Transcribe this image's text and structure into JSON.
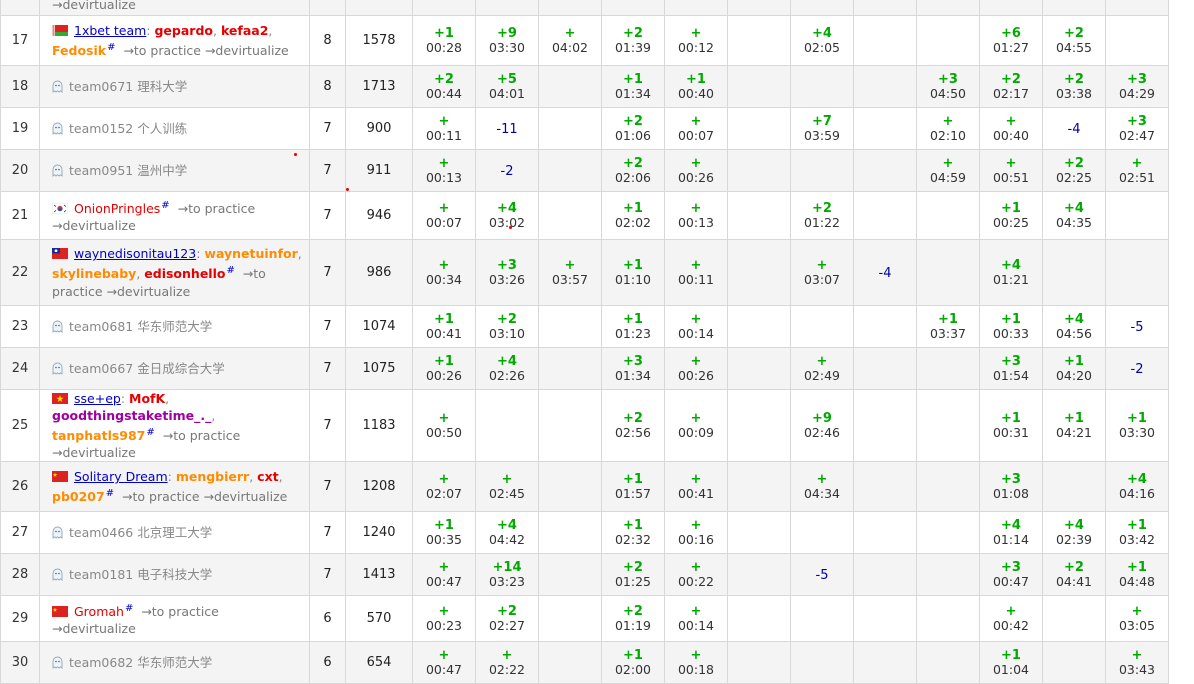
{
  "rows": [
    {
      "rank": "17",
      "solved": "8",
      "penalty": "1578",
      "flag": "by",
      "type": "named",
      "team": "1xbet team",
      "team_style": "link",
      "hash": true,
      "members": [
        {
          "name": "gepardo",
          "color": "red"
        },
        {
          "name": "kefaa2",
          "color": "red"
        },
        {
          "name": "Fedosik",
          "color": "orange"
        }
      ],
      "links": "→to practice →devirtualize",
      "cells": [
        [
          "+1",
          "00:28"
        ],
        [
          "+9",
          "03:30"
        ],
        [
          "+",
          "04:02"
        ],
        [
          "+2",
          "01:39"
        ],
        [
          "+",
          "00:12"
        ],
        [
          "",
          ""
        ],
        [
          "+4",
          "02:05"
        ],
        [
          "",
          ""
        ],
        [
          "",
          ""
        ],
        [
          "+6",
          "01:27"
        ],
        [
          "+2",
          "04:55"
        ],
        [
          "",
          ""
        ]
      ]
    },
    {
      "rank": "18",
      "solved": "8",
      "penalty": "1713",
      "type": "ghost",
      "team": "team0671 理科大学",
      "cells": [
        [
          "+2",
          "00:44"
        ],
        [
          "+5",
          "04:01"
        ],
        [
          "",
          ""
        ],
        [
          "+1",
          "01:34"
        ],
        [
          "+1",
          "00:40"
        ],
        [
          "",
          ""
        ],
        [
          "",
          ""
        ],
        [
          "",
          ""
        ],
        [
          "+3",
          "04:50"
        ],
        [
          "+2",
          "02:17"
        ],
        [
          "+2",
          "03:38"
        ],
        [
          "+3",
          "04:29"
        ]
      ]
    },
    {
      "rank": "19",
      "solved": "7",
      "penalty": "900",
      "type": "ghost",
      "team": "team0152 个人训练",
      "cells": [
        [
          "+",
          "00:11"
        ],
        [
          "-11",
          ""
        ],
        [
          "",
          ""
        ],
        [
          "+2",
          "01:06"
        ],
        [
          "+",
          "00:07"
        ],
        [
          "",
          ""
        ],
        [
          "+7",
          "03:59"
        ],
        [
          "",
          ""
        ],
        [
          "+",
          "02:10"
        ],
        [
          "+",
          "00:40"
        ],
        [
          "-4",
          ""
        ],
        [
          "+3",
          "02:47"
        ]
      ]
    },
    {
      "rank": "20",
      "solved": "7",
      "penalty": "911",
      "type": "ghost",
      "team": "team0951 温州中学",
      "cells": [
        [
          "+",
          "00:13"
        ],
        [
          "-2",
          ""
        ],
        [
          "",
          ""
        ],
        [
          "+2",
          "02:06"
        ],
        [
          "+",
          "00:26"
        ],
        [
          "",
          ""
        ],
        [
          "",
          ""
        ],
        [
          "",
          ""
        ],
        [
          "+",
          "04:59"
        ],
        [
          "+",
          "00:51"
        ],
        [
          "+2",
          "02:25"
        ],
        [
          "+",
          "02:51"
        ]
      ]
    },
    {
      "rank": "21",
      "solved": "7",
      "penalty": "946",
      "flag": "kr",
      "type": "named",
      "team": "OnionPringles",
      "team_style": "red",
      "hash": true,
      "members": [],
      "links": "→to practice →devirtualize",
      "cells": [
        [
          "+",
          "00:07"
        ],
        [
          "+4",
          "03:02"
        ],
        [
          "",
          ""
        ],
        [
          "+1",
          "02:02"
        ],
        [
          "+",
          "00:13"
        ],
        [
          "",
          ""
        ],
        [
          "+2",
          "01:22"
        ],
        [
          "",
          ""
        ],
        [
          "",
          ""
        ],
        [
          "+1",
          "00:25"
        ],
        [
          "+4",
          "04:35"
        ],
        [
          "",
          ""
        ]
      ]
    },
    {
      "rank": "22",
      "solved": "7",
      "penalty": "986",
      "flag": "tw",
      "type": "named",
      "team": "waynedisonitau123",
      "team_style": "link",
      "hash": true,
      "members": [
        {
          "name": "waynetuinfor",
          "color": "orange"
        },
        {
          "name": "skylinebaby",
          "color": "orange"
        },
        {
          "name": "edisonhello",
          "color": "red"
        }
      ],
      "links": "→to practice →devirtualize",
      "cells": [
        [
          "+",
          "00:34"
        ],
        [
          "+3",
          "03:26"
        ],
        [
          "+",
          "03:57"
        ],
        [
          "+1",
          "01:10"
        ],
        [
          "+",
          "00:11"
        ],
        [
          "",
          ""
        ],
        [
          "+",
          "03:07"
        ],
        [
          "-4",
          ""
        ],
        [
          "",
          ""
        ],
        [
          "+4",
          "01:21"
        ],
        [
          "",
          ""
        ],
        [
          "",
          ""
        ]
      ]
    },
    {
      "rank": "23",
      "solved": "7",
      "penalty": "1074",
      "type": "ghost",
      "team": "team0681 华东师范大学",
      "cells": [
        [
          "+1",
          "00:41"
        ],
        [
          "+2",
          "03:10"
        ],
        [
          "",
          ""
        ],
        [
          "+1",
          "01:23"
        ],
        [
          "+",
          "00:14"
        ],
        [
          "",
          ""
        ],
        [
          "",
          ""
        ],
        [
          "",
          ""
        ],
        [
          "+1",
          "03:37"
        ],
        [
          "+1",
          "00:33"
        ],
        [
          "+4",
          "04:56"
        ],
        [
          "-5",
          ""
        ]
      ]
    },
    {
      "rank": "24",
      "solved": "7",
      "penalty": "1075",
      "type": "ghost",
      "team": "team0667 金日成综合大学",
      "cells": [
        [
          "+1",
          "00:26"
        ],
        [
          "+4",
          "02:26"
        ],
        [
          "",
          ""
        ],
        [
          "+3",
          "01:34"
        ],
        [
          "+",
          "00:26"
        ],
        [
          "",
          ""
        ],
        [
          "+",
          "02:49"
        ],
        [
          "",
          ""
        ],
        [
          "",
          ""
        ],
        [
          "+3",
          "01:54"
        ],
        [
          "+1",
          "04:20"
        ],
        [
          "-2",
          ""
        ]
      ]
    },
    {
      "rank": "25",
      "solved": "7",
      "penalty": "1183",
      "flag": "vn",
      "type": "named",
      "team": "sse+ep",
      "team_style": "link",
      "hash": true,
      "members": [
        {
          "name": "MofK",
          "color": "red"
        },
        {
          "name": "goodthingstaketime_._",
          "color": "violet"
        },
        {
          "name": "tanphatls987",
          "color": "orange"
        }
      ],
      "links": "→to practice →devirtualize",
      "cells": [
        [
          "+",
          "00:50"
        ],
        [
          "",
          ""
        ],
        [
          "",
          ""
        ],
        [
          "+2",
          "02:56"
        ],
        [
          "+",
          "00:09"
        ],
        [
          "",
          ""
        ],
        [
          "+9",
          "02:46"
        ],
        [
          "",
          ""
        ],
        [
          "",
          ""
        ],
        [
          "+1",
          "00:31"
        ],
        [
          "+1",
          "04:21"
        ],
        [
          "+1",
          "03:30"
        ]
      ]
    },
    {
      "rank": "26",
      "solved": "7",
      "penalty": "1208",
      "flag": "cn",
      "type": "named",
      "team": "Solitary Dream",
      "team_style": "link",
      "hash": true,
      "members": [
        {
          "name": "mengbierr",
          "color": "orange"
        },
        {
          "name": "cxt",
          "color": "red"
        },
        {
          "name": "pb0207",
          "color": "orange"
        }
      ],
      "links": "→to practice →devirtualize",
      "cells": [
        [
          "+",
          "02:07"
        ],
        [
          "+",
          "02:45"
        ],
        [
          "",
          ""
        ],
        [
          "+1",
          "01:57"
        ],
        [
          "+",
          "00:41"
        ],
        [
          "",
          ""
        ],
        [
          "+",
          "04:34"
        ],
        [
          "",
          ""
        ],
        [
          "",
          ""
        ],
        [
          "+3",
          "01:08"
        ],
        [
          "",
          ""
        ],
        [
          "+4",
          "04:16"
        ]
      ]
    },
    {
      "rank": "27",
      "solved": "7",
      "penalty": "1240",
      "type": "ghost",
      "team": "team0466 北京理工大学",
      "cells": [
        [
          "+1",
          "00:35"
        ],
        [
          "+4",
          "04:42"
        ],
        [
          "",
          ""
        ],
        [
          "+1",
          "02:32"
        ],
        [
          "+",
          "00:16"
        ],
        [
          "",
          ""
        ],
        [
          "",
          ""
        ],
        [
          "",
          ""
        ],
        [
          "",
          ""
        ],
        [
          "+4",
          "01:14"
        ],
        [
          "+4",
          "02:39"
        ],
        [
          "+1",
          "03:42"
        ]
      ]
    },
    {
      "rank": "28",
      "solved": "7",
      "penalty": "1413",
      "type": "ghost",
      "team": "team0181 电子科技大学",
      "cells": [
        [
          "+",
          "00:47"
        ],
        [
          "+14",
          "03:23"
        ],
        [
          "",
          ""
        ],
        [
          "+2",
          "01:25"
        ],
        [
          "+",
          "00:22"
        ],
        [
          "",
          ""
        ],
        [
          "-5",
          ""
        ],
        [
          "",
          ""
        ],
        [
          "",
          ""
        ],
        [
          "+3",
          "00:47"
        ],
        [
          "+2",
          "04:41"
        ],
        [
          "+1",
          "04:48"
        ]
      ]
    },
    {
      "rank": "29",
      "solved": "6",
      "penalty": "570",
      "flag": "cn",
      "type": "named",
      "team": "Gromah",
      "team_style": "red",
      "hash": true,
      "members": [],
      "links": "→to practice →devirtualize",
      "cells": [
        [
          "+",
          "00:23"
        ],
        [
          "+2",
          "02:27"
        ],
        [
          "",
          ""
        ],
        [
          "+2",
          "01:19"
        ],
        [
          "+",
          "00:14"
        ],
        [
          "",
          ""
        ],
        [
          "",
          ""
        ],
        [
          "",
          ""
        ],
        [
          "",
          ""
        ],
        [
          "+",
          "00:42"
        ],
        [
          "",
          ""
        ],
        [
          "+",
          "03:05"
        ]
      ]
    },
    {
      "rank": "30",
      "solved": "6",
      "penalty": "654",
      "type": "ghost",
      "team": "team0682 华东师范大学",
      "cells": [
        [
          "+",
          "00:47"
        ],
        [
          "+",
          "02:22"
        ],
        [
          "",
          ""
        ],
        [
          "+1",
          "02:00"
        ],
        [
          "+",
          "00:18"
        ],
        [
          "",
          ""
        ],
        [
          "",
          ""
        ],
        [
          "",
          ""
        ],
        [
          "",
          ""
        ],
        [
          "+1",
          "01:04"
        ],
        [
          "",
          ""
        ],
        [
          "+",
          "03:43"
        ]
      ]
    }
  ],
  "top_partial": "→devirtualize"
}
